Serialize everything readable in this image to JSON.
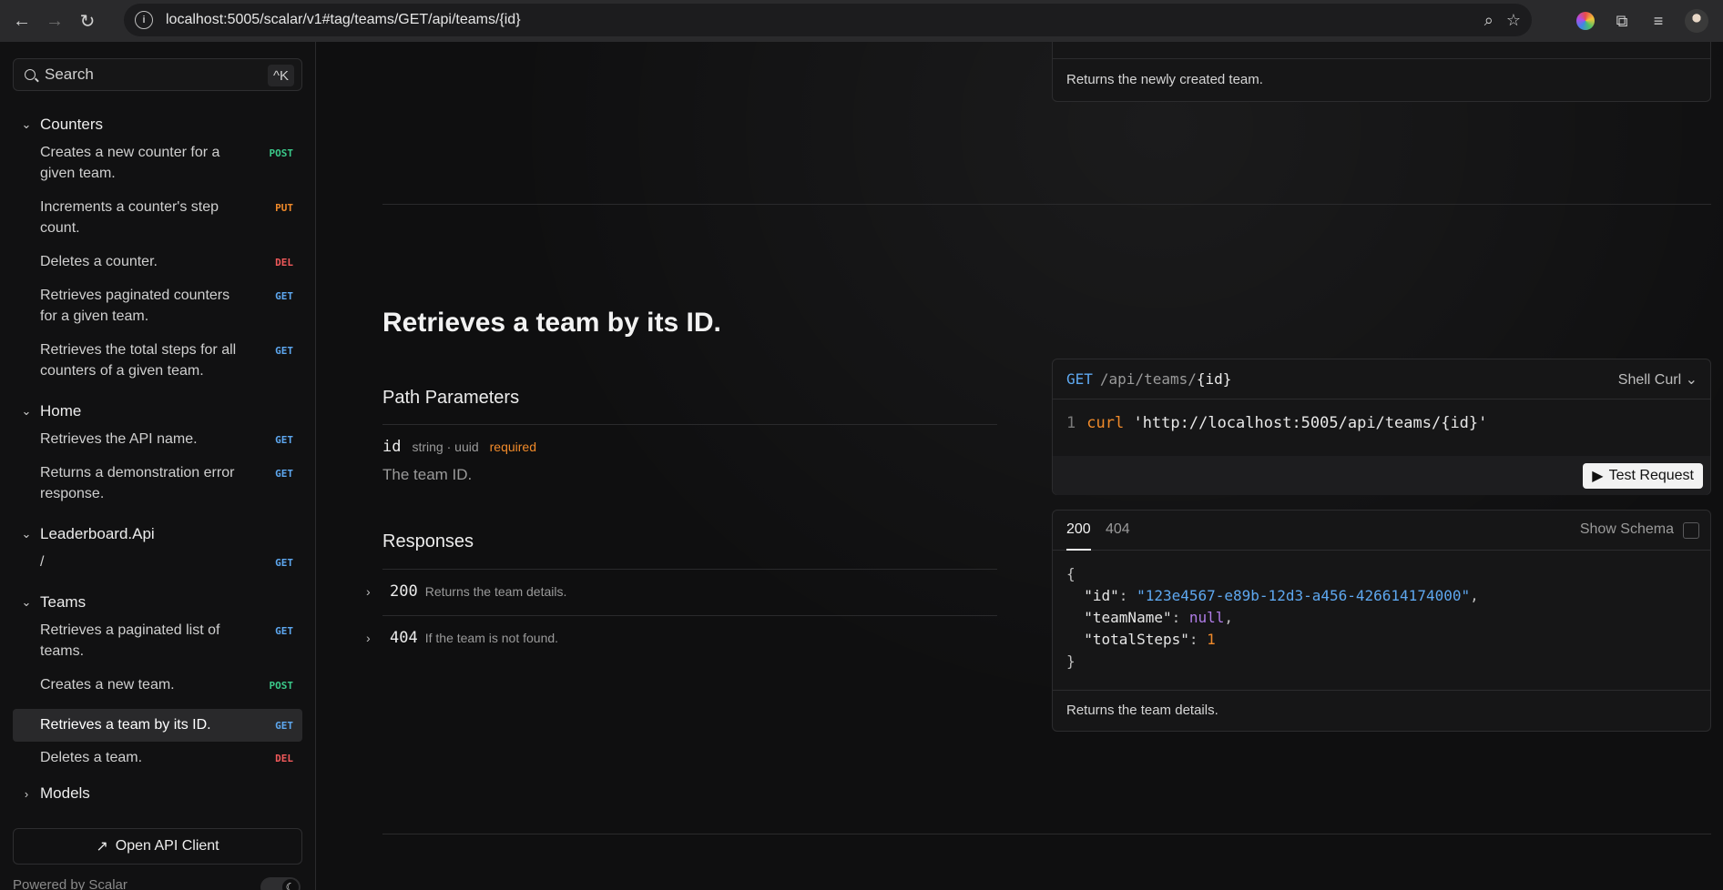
{
  "browser": {
    "url": "localhost:5005/scalar/v1#tag/teams/GET/api/teams/{id}"
  },
  "sidebar": {
    "search_label": "Search",
    "search_shortcut": "^K",
    "groups": [
      {
        "title": "Counters",
        "items": [
          {
            "label": "Creates a new counter for a given team.",
            "method": "POST"
          },
          {
            "label": "Increments a counter's step count.",
            "method": "PUT"
          },
          {
            "label": "Deletes a counter.",
            "method": "DEL"
          },
          {
            "label": "Retrieves paginated counters for a given team.",
            "method": "GET"
          },
          {
            "label": "Retrieves the total steps for all counters of a given team.",
            "method": "GET"
          }
        ]
      },
      {
        "title": "Home",
        "items": [
          {
            "label": "Retrieves the API name.",
            "method": "GET"
          },
          {
            "label": "Returns a demonstration error response.",
            "method": "GET"
          }
        ]
      },
      {
        "title": "Leaderboard.Api",
        "items": [
          {
            "label": "/",
            "method": "GET"
          }
        ]
      },
      {
        "title": "Teams",
        "items": [
          {
            "label": "Retrieves a paginated list of teams.",
            "method": "GET"
          },
          {
            "label": "Creates a new team.",
            "method": "POST"
          },
          {
            "label": "Retrieves a team by its ID.",
            "method": "GET"
          },
          {
            "label": "Deletes a team.",
            "method": "DEL"
          }
        ]
      },
      {
        "title": "Models",
        "items": []
      }
    ],
    "open_client": "Open API Client",
    "powered_by": "Powered by Scalar"
  },
  "main": {
    "previous_response_desc": "Returns the newly created team.",
    "operation_title": "Retrieves a team by its ID.",
    "path_params_title": "Path Parameters",
    "param": {
      "name": "id",
      "type": "string · uuid",
      "required": "required",
      "description": "The team ID."
    },
    "responses_title": "Responses",
    "responses": [
      {
        "code": "200",
        "description": "Returns the team details."
      },
      {
        "code": "404",
        "description": "If the team is not found."
      }
    ],
    "request": {
      "method": "GET",
      "path_prefix": "/api/teams/",
      "path_var": "{id}",
      "language": "Shell Curl",
      "line_number": "1",
      "cmd": "curl",
      "url": "'http://localhost:5005/api/teams/{id}'",
      "test_button": "Test Request"
    },
    "response_card": {
      "tabs": [
        "200",
        "404"
      ],
      "show_schema": "Show Schema",
      "json": {
        "open": "{",
        "k1": "\"id\"",
        "v1": "\"123e4567-e89b-12d3-a456-426614174000\"",
        "k2": "\"teamName\"",
        "v2": "null",
        "k3": "\"totalSteps\"",
        "v3": "1",
        "close": "}"
      },
      "description": "Returns the team details."
    }
  }
}
